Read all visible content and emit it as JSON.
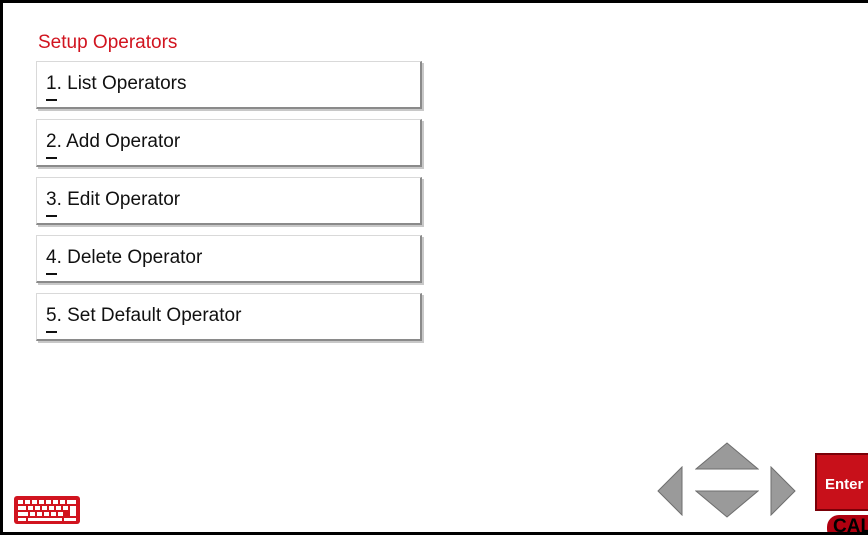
{
  "title": "Setup Operators",
  "menu": {
    "items": [
      {
        "num": "1",
        "label": ". List Operators"
      },
      {
        "num": "2",
        "label": ". Add Operator"
      },
      {
        "num": "3",
        "label": ". Edit Operator"
      },
      {
        "num": "4",
        "label": ". Delete Operator"
      },
      {
        "num": "5",
        "label": ". Set Default Operator"
      }
    ]
  },
  "buttons": {
    "enter_label": "Enter",
    "cal_label": "CAL"
  },
  "icons": {
    "keyboard": "keyboard-icon",
    "nav_left": "arrow-left-icon",
    "nav_up": "arrow-up-icon",
    "nav_down": "arrow-down-icon",
    "nav_right": "arrow-right-icon"
  },
  "colors": {
    "accent_red": "#d1141f",
    "button_red": "#c8101a",
    "arrow_gray": "#9a9a9a"
  }
}
